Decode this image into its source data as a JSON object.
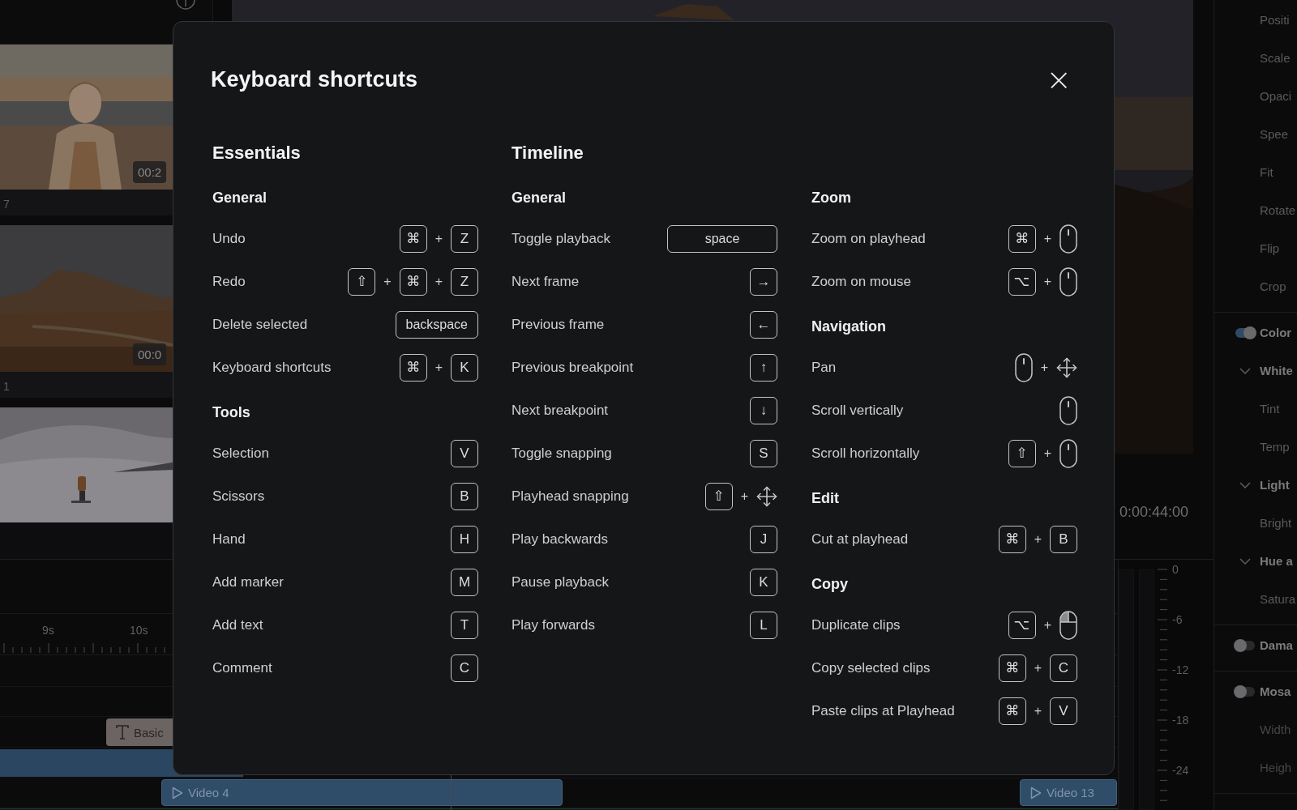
{
  "media": {
    "clips": [
      {
        "kind": "picture",
        "duration": "00:2",
        "label": "7"
      },
      {
        "kind": "picture",
        "duration": "00:0",
        "label": "1"
      },
      {
        "kind": "picture"
      }
    ]
  },
  "preview": {
    "timecode": "0:00:44:00"
  },
  "timeline": {
    "ruler": [
      "9s",
      "10s"
    ],
    "clips": [
      {
        "kind": "text",
        "label": "Basic"
      },
      {
        "kind": "bar"
      },
      {
        "kind": "video",
        "label": "Video 4"
      },
      {
        "kind": "video",
        "label": "Video 13"
      }
    ]
  },
  "meter": {
    "scale": [
      "0",
      "-6",
      "-12",
      "-18",
      "-24"
    ]
  },
  "inspector": {
    "groups": [
      {
        "items": [
          {
            "kind": "property",
            "label": "Positi",
            "disabled": false
          },
          {
            "kind": "property",
            "label": "Scale",
            "disabled": false
          },
          {
            "kind": "property",
            "label": "Opaci",
            "disabled": false
          },
          {
            "kind": "property",
            "label": "Spee",
            "disabled": false
          },
          {
            "kind": "property",
            "label": "Fit",
            "disabled": false
          },
          {
            "kind": "property",
            "label": "Rotate",
            "disabled": false
          },
          {
            "kind": "property",
            "label": "Flip",
            "disabled": false
          },
          {
            "kind": "property",
            "label": "Crop",
            "disabled": false
          }
        ]
      },
      {
        "items": [
          {
            "kind": "toggle",
            "label": "Color",
            "on": true
          },
          {
            "kind": "section",
            "label": "White",
            "expanded": true
          },
          {
            "kind": "property",
            "label": "Tint",
            "disabled": false
          },
          {
            "kind": "property",
            "label": "Temp",
            "disabled": false
          },
          {
            "kind": "section",
            "label": "Light",
            "expanded": true
          },
          {
            "kind": "property",
            "label": "Bright",
            "disabled": false
          },
          {
            "kind": "section",
            "label": "Hue a",
            "expanded": true
          },
          {
            "kind": "property",
            "label": "Satura",
            "disabled": false
          }
        ]
      },
      {
        "items": [
          {
            "kind": "toggle",
            "label": "Dama",
            "on": false
          }
        ]
      },
      {
        "items": [
          {
            "kind": "toggle",
            "label": "Mosa",
            "on": false
          },
          {
            "kind": "property",
            "label": "Width",
            "disabled": true
          },
          {
            "kind": "property",
            "label": "Heigh",
            "disabled": true
          }
        ]
      }
    ]
  },
  "dialog": {
    "title": "Keyboard shortcuts",
    "close": "×",
    "sections": [
      {
        "heading": "Essentials",
        "columns": [
          [
            {
              "title": "General",
              "shortcuts": [
                {
                  "label": "Undo",
                  "keys": [
                    {
                      "kind": "key",
                      "text": "⌘"
                    },
                    {
                      "kind": "plus",
                      "text": "+"
                    },
                    {
                      "kind": "key",
                      "text": "Z"
                    }
                  ]
                },
                {
                  "label": "Redo",
                  "keys": [
                    {
                      "kind": "key",
                      "text": "⇧"
                    },
                    {
                      "kind": "plus",
                      "text": "+"
                    },
                    {
                      "kind": "key",
                      "text": "⌘"
                    },
                    {
                      "kind": "plus",
                      "text": "+"
                    },
                    {
                      "kind": "key",
                      "text": "Z"
                    }
                  ]
                },
                {
                  "label": "Delete selected",
                  "keys": [
                    {
                      "kind": "word-key",
                      "text": "backspace"
                    }
                  ]
                },
                {
                  "label": "Keyboard shortcuts",
                  "keys": [
                    {
                      "kind": "key",
                      "text": "⌘"
                    },
                    {
                      "kind": "plus",
                      "text": "+"
                    },
                    {
                      "kind": "key",
                      "text": "K"
                    }
                  ]
                }
              ]
            },
            {
              "title": "Tools",
              "shortcuts": [
                {
                  "label": "Selection",
                  "keys": [
                    {
                      "kind": "key",
                      "text": "V"
                    }
                  ]
                },
                {
                  "label": "Scissors",
                  "keys": [
                    {
                      "kind": "key",
                      "text": "B"
                    }
                  ]
                },
                {
                  "label": "Hand",
                  "keys": [
                    {
                      "kind": "key",
                      "text": "H"
                    }
                  ]
                },
                {
                  "label": "Add marker",
                  "keys": [
                    {
                      "kind": "key",
                      "text": "M"
                    }
                  ]
                },
                {
                  "label": "Add text",
                  "keys": [
                    {
                      "kind": "key",
                      "text": "T"
                    }
                  ]
                },
                {
                  "label": "Comment",
                  "keys": [
                    {
                      "kind": "key",
                      "text": "C"
                    }
                  ]
                }
              ]
            }
          ]
        ]
      },
      {
        "heading": "Timeline",
        "columns": [
          [
            {
              "title": "General",
              "shortcuts": [
                {
                  "label": "Toggle playback",
                  "keys": [
                    {
                      "kind": "spacebar",
                      "text": "space"
                    }
                  ]
                },
                {
                  "label": "Next frame",
                  "keys": [
                    {
                      "kind": "key",
                      "text": "→"
                    }
                  ]
                },
                {
                  "label": "Previous frame",
                  "keys": [
                    {
                      "kind": "key",
                      "text": "←"
                    }
                  ]
                },
                {
                  "label": "Previous breakpoint",
                  "keys": [
                    {
                      "kind": "key",
                      "text": "↑"
                    }
                  ]
                },
                {
                  "label": "Next breakpoint",
                  "keys": [
                    {
                      "kind": "key",
                      "text": "↓"
                    }
                  ]
                },
                {
                  "label": "Toggle snapping",
                  "keys": [
                    {
                      "kind": "key",
                      "text": "S"
                    }
                  ]
                },
                {
                  "label": "Playhead snapping",
                  "keys": [
                    {
                      "kind": "key",
                      "text": "⇧"
                    },
                    {
                      "kind": "plus",
                      "text": "+"
                    },
                    {
                      "kind": "move"
                    }
                  ]
                },
                {
                  "label": "Play backwards",
                  "keys": [
                    {
                      "kind": "key",
                      "text": "J"
                    }
                  ]
                },
                {
                  "label": "Pause playback",
                  "keys": [
                    {
                      "kind": "key",
                      "text": "K"
                    }
                  ]
                },
                {
                  "label": "Play forwards",
                  "keys": [
                    {
                      "kind": "key",
                      "text": "L"
                    }
                  ]
                }
              ]
            }
          ],
          [
            {
              "title": "Zoom",
              "shortcuts": [
                {
                  "label": "Zoom on playhead",
                  "keys": [
                    {
                      "kind": "key",
                      "text": "⌘"
                    },
                    {
                      "kind": "plus",
                      "text": "+"
                    },
                    {
                      "kind": "mouse"
                    }
                  ]
                },
                {
                  "label": "Zoom on mouse",
                  "keys": [
                    {
                      "kind": "key",
                      "text": "⌥"
                    },
                    {
                      "kind": "plus",
                      "text": "+"
                    },
                    {
                      "kind": "mouse"
                    }
                  ]
                }
              ]
            },
            {
              "title": "Navigation",
              "shortcuts": [
                {
                  "label": "Pan",
                  "keys": [
                    {
                      "kind": "mouse"
                    },
                    {
                      "kind": "plus",
                      "text": "+"
                    },
                    {
                      "kind": "move"
                    }
                  ]
                },
                {
                  "label": "Scroll vertically",
                  "keys": [
                    {
                      "kind": "mouse"
                    }
                  ]
                },
                {
                  "label": "Scroll horizontally",
                  "keys": [
                    {
                      "kind": "key",
                      "text": "⇧"
                    },
                    {
                      "kind": "plus",
                      "text": "+"
                    },
                    {
                      "kind": "mouse"
                    }
                  ]
                }
              ]
            },
            {
              "title": "Edit",
              "shortcuts": [
                {
                  "label": "Cut at playhead",
                  "keys": [
                    {
                      "kind": "key",
                      "text": "⌘"
                    },
                    {
                      "kind": "plus",
                      "text": "+"
                    },
                    {
                      "kind": "key",
                      "text": "B"
                    }
                  ]
                }
              ]
            },
            {
              "title": "Copy",
              "shortcuts": [
                {
                  "label": "Duplicate clips",
                  "keys": [
                    {
                      "kind": "key",
                      "text": "⌥"
                    },
                    {
                      "kind": "plus",
                      "text": "+"
                    },
                    {
                      "kind": "mouse-click"
                    }
                  ]
                },
                {
                  "label": "Copy selected clips",
                  "keys": [
                    {
                      "kind": "key",
                      "text": "⌘"
                    },
                    {
                      "kind": "plus",
                      "text": "+"
                    },
                    {
                      "kind": "key",
                      "text": "C"
                    }
                  ]
                },
                {
                  "label": "Paste clips at Playhead",
                  "keys": [
                    {
                      "kind": "key",
                      "text": "⌘"
                    },
                    {
                      "kind": "plus",
                      "text": "+"
                    },
                    {
                      "kind": "key",
                      "text": "V"
                    }
                  ]
                }
              ]
            }
          ]
        ]
      }
    ]
  }
}
